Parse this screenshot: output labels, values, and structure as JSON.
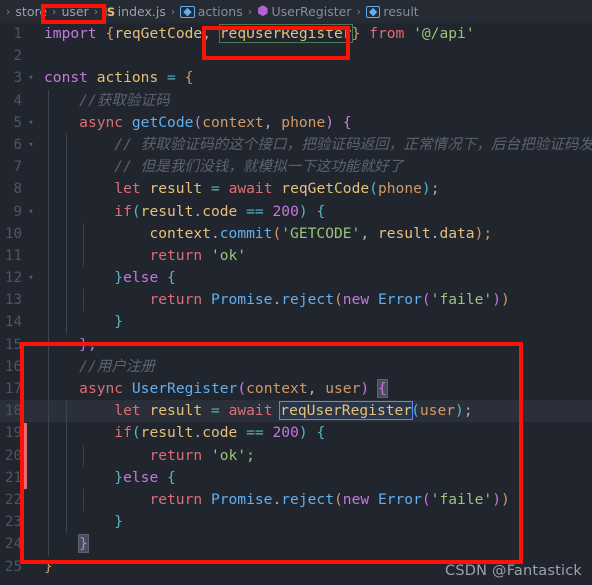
{
  "breadcrumb": {
    "items": [
      {
        "icon": "folder-icon",
        "label": "store",
        "kind": "folder"
      },
      {
        "icon": "folder-icon",
        "label": "user",
        "kind": "folder"
      },
      {
        "icon": "js-file-icon",
        "label": "index.js",
        "kind": "file"
      },
      {
        "icon": "cube-icon",
        "label": "actions",
        "kind": "symbol"
      },
      {
        "icon": "method-icon",
        "label": "UserRegister",
        "kind": "method"
      },
      {
        "icon": "cube-icon",
        "label": "result",
        "kind": "symbol"
      }
    ],
    "separator": "›"
  },
  "editor": {
    "language": "javascript",
    "file_name": "index.js",
    "first_line": 1,
    "last_line": 25,
    "line_numbers": [
      "1",
      "2",
      "3",
      "4",
      "5",
      "6",
      "7",
      "8",
      "9",
      "10",
      "11",
      "12",
      "13",
      "14",
      "15",
      "16",
      "17",
      "18",
      "19",
      "20",
      "21",
      "22",
      "23",
      "24",
      "25"
    ],
    "lines": {
      "l1": "import {reqGetCode, reqUserRegister} from '@/api'",
      "l2": "",
      "l3": "const actions = {",
      "l4": "    //获取验证码",
      "l5": "    async getCode(context, phone) {",
      "l6": "        // 获取验证码的这个接口，把验证码返回，正常情况下，后台把验证码发",
      "l7": "        // 但是我们没钱，就模拟一下这功能就好了",
      "l8": "        let result = await reqGetCode(phone);",
      "l9": "        if(result.code == 200) {",
      "l10": "            context.commit('GETCODE', result.data);",
      "l11": "            return 'ok'",
      "l12": "        }else {",
      "l13": "            return Promise.reject(new Error('faile'))",
      "l14": "        }",
      "l15": "    },",
      "l16": "    //用户注册",
      "l17": "    async UserRegister(context, user) {",
      "l18": "        let result = await reqUserRegister(user);",
      "l19": "        if(result.code == 200) {",
      "l20": "            return 'ok';",
      "l21": "        }else {",
      "l22": "            return Promise.reject(new Error('faile'))",
      "l23": "        }",
      "l24": "    }",
      "l25": "}"
    },
    "tokens": {
      "import": "import",
      "from": "from",
      "const": "const",
      "async": "async",
      "let": "let",
      "await": "await",
      "return": "return",
      "if": "if",
      "else": "else",
      "new": "new",
      "reqGetCode": "reqGetCode",
      "reqUserRegister": "reqUserRegister",
      "api_path": "'@/api'",
      "actions": "actions",
      "getCode": "getCode",
      "UserRegister": "UserRegister",
      "context": "context",
      "phone": "phone",
      "user": "user",
      "result": "result",
      "code": "code",
      "data": "data",
      "commit": "commit",
      "Promise": "Promise",
      "reject": "reject",
      "Error": "Error",
      "status_200": "200",
      "str_GETCODE": "'GETCODE'",
      "str_ok": "'ok'",
      "str_ok_semi": "'ok';",
      "str_faile": "'faile'",
      "comment_getcode": "//获取验证码",
      "comment_long1": "// 获取验证码的这个接口，把验证码返回，正常情况下，后台把验证码发",
      "comment_long2": "// 但是我们没钱，就模拟一下这功能就好了",
      "comment_register": "//用户注册"
    },
    "selection": {
      "text": "reqUserRegister",
      "line": 18
    },
    "fold_lines": [
      3,
      5,
      6,
      9,
      12,
      17,
      19,
      21
    ]
  },
  "annotations": {
    "color": "#fc1307",
    "boxes": [
      {
        "name": "breadcrumb-user-highlight",
        "target": "user"
      },
      {
        "name": "import-reqUserRegister-highlight",
        "target": "reqUserRegister"
      },
      {
        "name": "userregister-action-block-highlight",
        "target": "UserRegister action block"
      }
    ]
  },
  "watermark": {
    "text": "CSDN @Fantastick"
  }
}
